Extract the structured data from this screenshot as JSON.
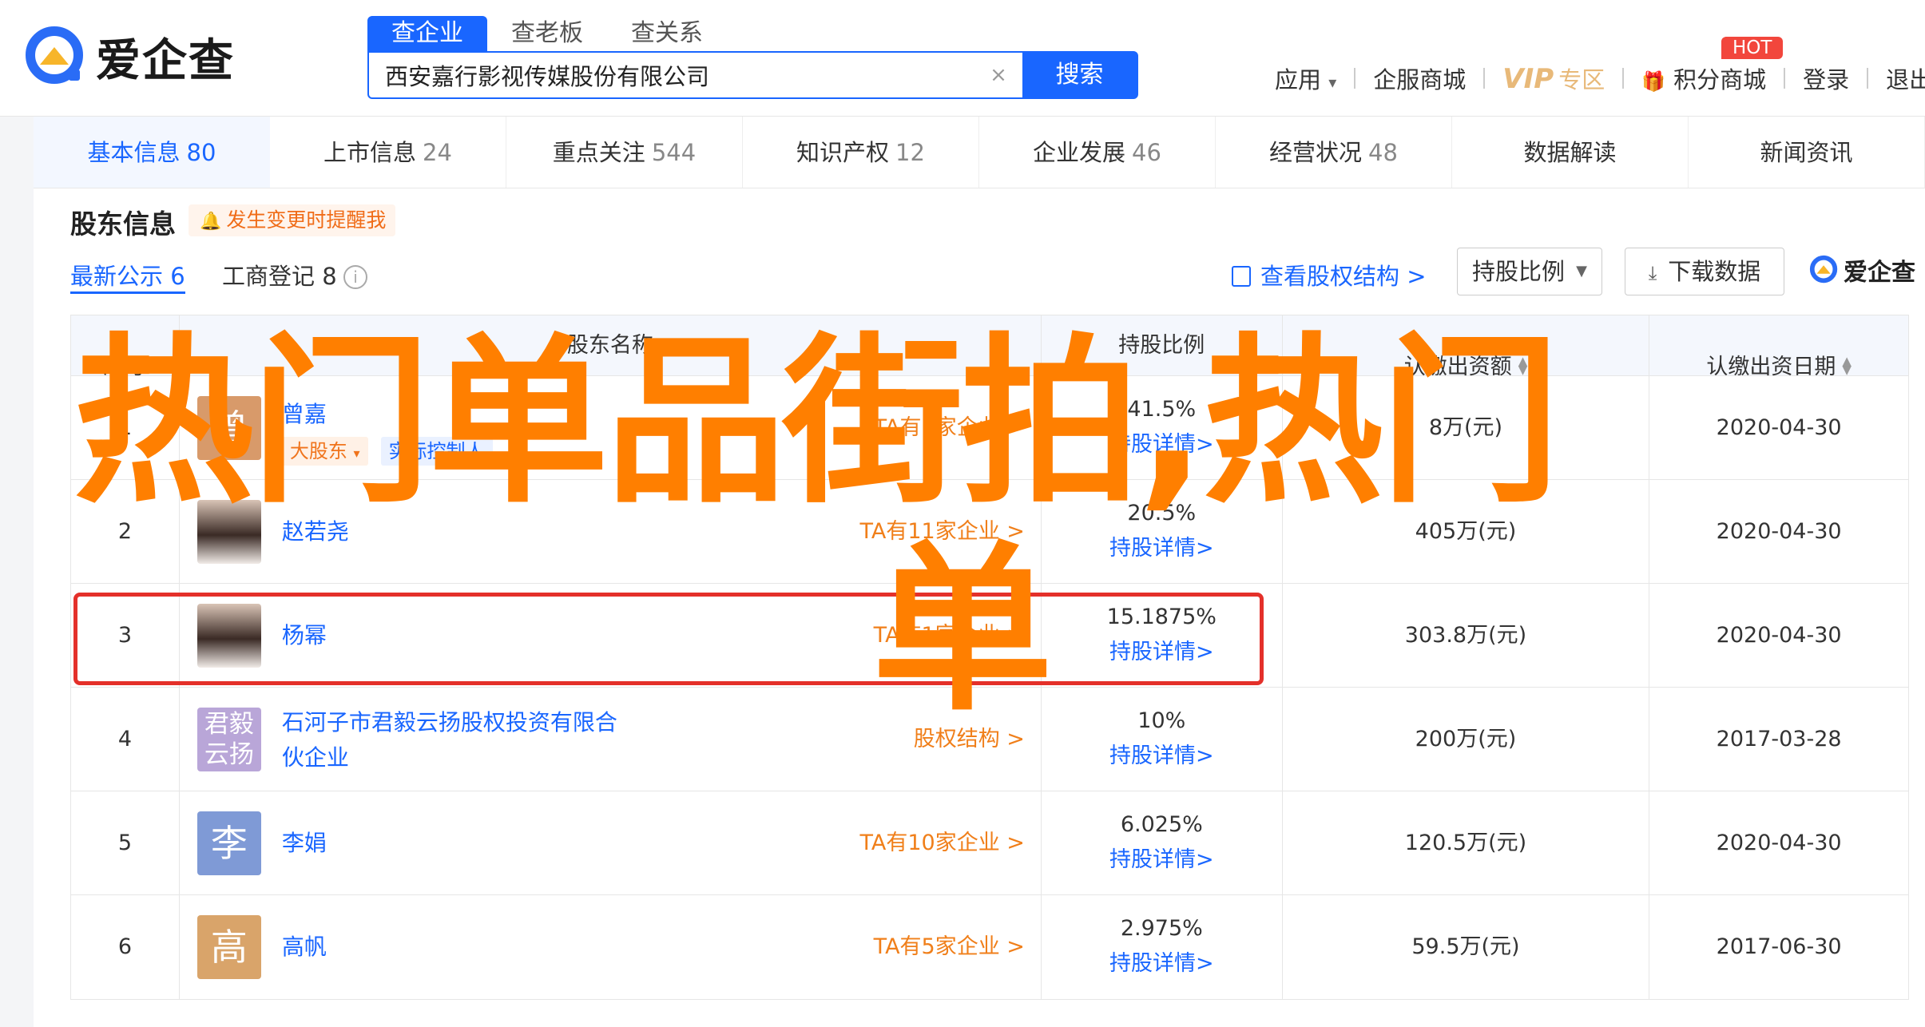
{
  "header": {
    "logo_text": "爱企查",
    "search_tabs": [
      "查企业",
      "查老板",
      "查关系"
    ],
    "search_value": "西安嘉行影视传媒股份有限公司",
    "search_clear": "×",
    "search_button": "搜索",
    "nav": {
      "apps": "应用",
      "apps_caret": "▾",
      "service": "企服商城",
      "vip": "VIP",
      "vip_sub": "专区",
      "points": "积分商城",
      "hot": "HOT",
      "login": "登录",
      "logout": "退出"
    }
  },
  "section_nav": [
    {
      "label": "基本信息",
      "count": "80"
    },
    {
      "label": "上市信息",
      "count": "24"
    },
    {
      "label": "重点关注",
      "count": "544"
    },
    {
      "label": "知识产权",
      "count": "12"
    },
    {
      "label": "企业发展",
      "count": "46"
    },
    {
      "label": "经营状况",
      "count": "48"
    },
    {
      "label": "数据解读",
      "count": ""
    },
    {
      "label": "新闻资讯",
      "count": ""
    }
  ],
  "shareholders": {
    "title": "股东信息",
    "remind": "发生变更时提醒我",
    "tab_latest": "最新公示 6",
    "tab_registry": "工商登记 8",
    "info_mark": "i",
    "equity_link": "查看股权结构 >",
    "ratio_select": "持股比例",
    "download": "下载数据",
    "small_logo": "爱企查"
  },
  "table": {
    "headers": [
      "序号",
      "股东名称",
      "持股比例",
      "认缴出资额",
      "认缴出资日期"
    ],
    "rows": [
      {
        "no": "1",
        "avatar": "曾",
        "name": "曾嘉",
        "tag1": "大股东",
        "tag2": "实际控制人",
        "rel": "TA有1家企业 >",
        "ratio": "41.5%",
        "detail": "持股详情>",
        "capital": "8万(元)",
        "date": "2020-04-30"
      },
      {
        "no": "2",
        "avatar": "",
        "name": "赵若尧",
        "rel": "TA有11家企业 >",
        "ratio": "20.5%",
        "detail": "持股详情>",
        "capital": "405万(元)",
        "date": "2020-04-30"
      },
      {
        "no": "3",
        "avatar": "",
        "name": "杨幂",
        "rel": "TA有1家企业 >",
        "ratio": "15.1875%",
        "detail": "持股详情>",
        "capital": "303.8万(元)",
        "date": "2020-04-30"
      },
      {
        "no": "4",
        "avatar": "君毅云扬",
        "name": "石河子市君毅云扬股权投资有限合伙企业",
        "rel": "股权结构 >",
        "ratio": "10%",
        "detail": "持股详情>",
        "capital": "200万(元)",
        "date": "2017-03-28"
      },
      {
        "no": "5",
        "avatar": "李",
        "name": "李娟",
        "rel": "TA有10家企业 >",
        "ratio": "6.025%",
        "detail": "持股详情>",
        "capital": "120.5万(元)",
        "date": "2020-04-30"
      },
      {
        "no": "6",
        "avatar": "高",
        "name": "高帆",
        "rel": "TA有5家企业 >",
        "ratio": "2.975%",
        "detail": "持股详情>",
        "capital": "59.5万(元)",
        "date": "2017-06-30"
      }
    ]
  },
  "overlay": {
    "line1": "热门单品街拍,热门",
    "line2": "单"
  },
  "colors": {
    "brand_blue": "#1966ff",
    "relation_orange": "#f07f1a",
    "highlight_red": "#e4302a",
    "overlay_orange": "#ff7f00"
  }
}
